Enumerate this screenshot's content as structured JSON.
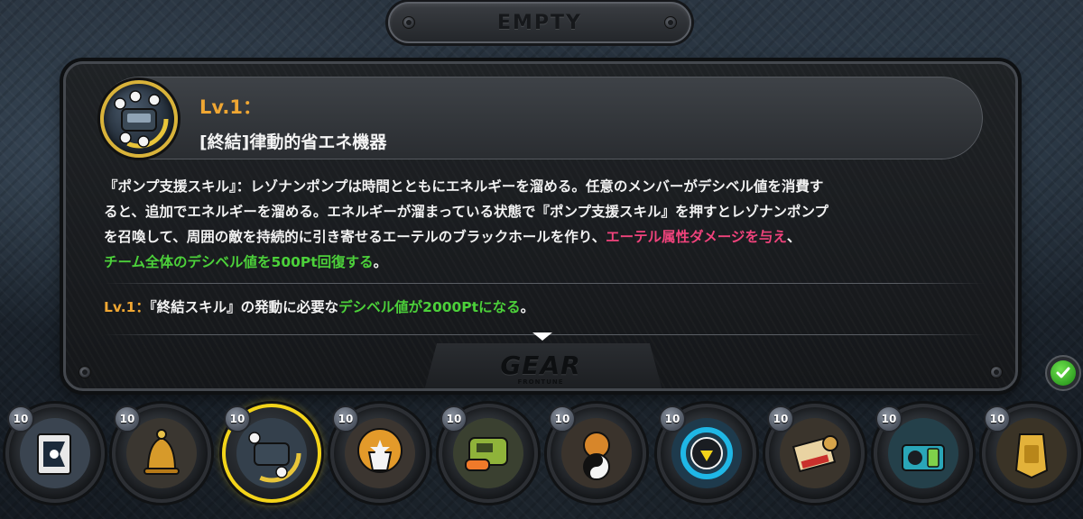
{
  "top_plate": {
    "label": "EMPTY"
  },
  "detail": {
    "level_title": "Lv.1：",
    "gear_name": "[終結]律動的省エネ機器",
    "description": {
      "line1": "『ポンプ支援スキル』：レゾナンポンプは時間とともにエネルギーを溜める。任意のメンバーがデシベル値を消費す",
      "line2": "ると、追加でエネルギーを溜める。エネルギーが溜まっている状態で『ポンプ支援スキル』を押すとレゾナンポンプ",
      "line3_plain": "を召喚して、周囲の敵を持続的に引き寄せるエーテルのブラックホールを作り、",
      "line3_pink": "エーテル属性ダメージを与え",
      "line3_tail": "、",
      "line4_green": "チーム全体のデシベル値を500Pt回復する",
      "line4_tail": "。"
    },
    "level_effect": {
      "prefix": "Lv.1：",
      "plain": "『終結スキル』の発動に必要な",
      "green": "デシベル値が2000Ptになる",
      "tail": "。"
    },
    "footer_logo": "GEAR",
    "footer_sub": "FRONTUNE"
  },
  "colors": {
    "accent_orange": "#f0a733",
    "accent_pink": "#f0437c",
    "accent_green": "#4cd13a",
    "selected_ring": "#f3d41a"
  },
  "slots": [
    {
      "level": "10",
      "icon": "flag-gear-icon"
    },
    {
      "level": "10",
      "icon": "bell-gear-icon"
    },
    {
      "level": "10",
      "icon": "energy-device-gear-icon",
      "selected": true
    },
    {
      "level": "10",
      "icon": "shield-bot-gear-icon"
    },
    {
      "level": "10",
      "icon": "blaster-gear-icon"
    },
    {
      "level": "10",
      "icon": "yinyang-bot-gear-icon"
    },
    {
      "level": "10",
      "icon": "visor-gear-icon"
    },
    {
      "level": "10",
      "icon": "scroll-gear-icon"
    },
    {
      "level": "10",
      "icon": "toolbox-gear-icon"
    },
    {
      "level": "10",
      "icon": "gold-tag-gear-icon"
    }
  ]
}
